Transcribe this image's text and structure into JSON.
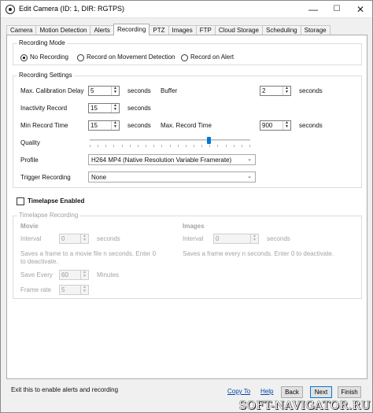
{
  "window": {
    "title": "Edit Camera (ID: 1, DIR: RGTPS)",
    "minimize": "—",
    "maximize": "☐",
    "close": "✕"
  },
  "tabs": [
    "Camera",
    "Motion Detection",
    "Alerts",
    "Recording",
    "PTZ",
    "Images",
    "FTP",
    "Cloud Storage",
    "Scheduling",
    "Storage"
  ],
  "active_tab": "Recording",
  "recording_mode": {
    "legend": "Recording Mode",
    "options": [
      "No Recording",
      "Record on Movement Detection",
      "Record on Alert"
    ],
    "selected": "No Recording"
  },
  "recording_settings": {
    "legend": "Recording Settings",
    "max_calibration_delay": {
      "label": "Max. Calibration Delay",
      "value": "5",
      "unit": "seconds"
    },
    "buffer": {
      "label": "Buffer",
      "value": "2",
      "unit": "seconds"
    },
    "inactivity_record": {
      "label": "Inactivity Record",
      "value": "15",
      "unit": "seconds"
    },
    "min_record_time": {
      "label": "Min Record Time",
      "value": "15",
      "unit": "seconds"
    },
    "max_record_time": {
      "label": "Max. Record Time",
      "value": "900",
      "unit": "seconds"
    },
    "quality": {
      "label": "Quality",
      "level": 0.75
    },
    "profile": {
      "label": "Profile",
      "value": "H264 MP4 (Native Resolution Variable Framerate)"
    },
    "trigger_recording": {
      "label": "Trigger Recording",
      "value": "None"
    }
  },
  "timelapse": {
    "checkbox_label": "Timelapse Enabled",
    "checked": false,
    "legend": "Timelapse Recording",
    "movie": {
      "title": "Movie",
      "interval_label": "Interval",
      "interval_value": "0",
      "interval_unit": "seconds",
      "description": "Saves a frame to a movie file n seconds. Enter 0 to deactivate.",
      "save_every_label": "Save Every",
      "save_every_value": "60",
      "save_every_unit": "Minutes",
      "frame_rate_label": "Frame rate",
      "frame_rate_value": "5"
    },
    "images": {
      "title": "Images",
      "interval_label": "Interval",
      "interval_value": "0",
      "interval_unit": "seconds",
      "description": "Saves a frame every n seconds. Enter 0 to deactivate."
    }
  },
  "footer": {
    "status": "Exit this to enable alerts and recording",
    "copy_to": "Copy To",
    "help": "Help",
    "back": "Back",
    "next": "Next",
    "finish": "Finish"
  },
  "watermark": "SOFT-NAVIGATOR.RU",
  "colors": {
    "accent": "#0078d7",
    "link": "#0645ad",
    "disabled_text": "#a3a3a3"
  }
}
